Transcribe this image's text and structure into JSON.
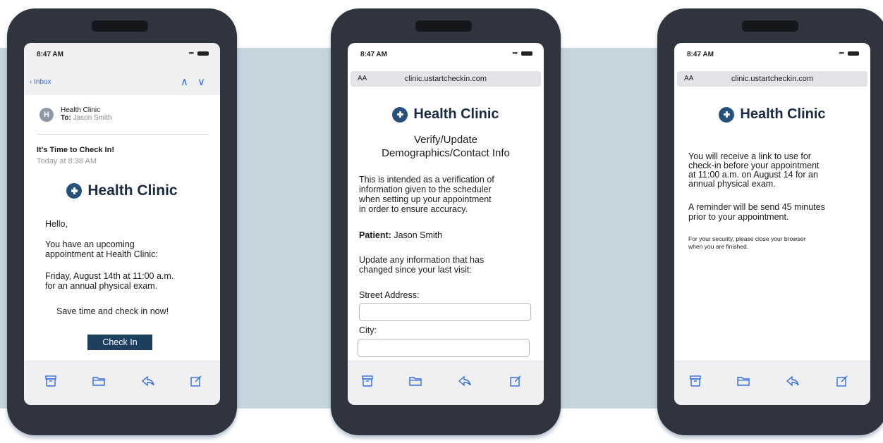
{
  "status": {
    "time": "8:47 AM",
    "signal": "•••"
  },
  "brand": {
    "name": "Health Clinic",
    "accent": "#27517d",
    "band_color": "#c5d5de"
  },
  "phone1": {
    "back_label": "Inbox",
    "nav_up": "∧",
    "nav_down": "∨",
    "avatar_letter": "H",
    "sender": "Health Clinic",
    "to_label": "To:",
    "to_name": "Jason Smith",
    "subject": "It's Time to Check In!",
    "date": "Today at 8:38 AM",
    "greeting": "Hello,",
    "body1_line1": "You have an upcoming",
    "body1_line2": "appointment at Health Clinic:",
    "body2_line1": "Friday, August 14th at 11:00 a.m.",
    "body2_line2": "for an annual physical exam.",
    "cta_text": "Save time and check in now!",
    "button": "Check In"
  },
  "phone2": {
    "aa": "AA",
    "url": "clinic.ustartcheckin.com",
    "heading_line1": "Verify/Update",
    "heading_line2": "Demographics/Contact Info",
    "intro_line1": "This is intended as a verification of",
    "intro_line2": "information given to the scheduler",
    "intro_line3": "when setting up your appointment",
    "intro_line4": "in order to ensure accuracy.",
    "patient_label": "Patient:",
    "patient_name": "Jason Smith",
    "update_line1": "Update any information that has",
    "update_line2": "changed since your last visit:",
    "street_label": "Street Address:",
    "street_value": "",
    "city_label": "City:",
    "city_value": ""
  },
  "phone3": {
    "aa": "AA",
    "url": "clinic.ustartcheckin.com",
    "msg1_line1": "You will receive a link to use for",
    "msg1_line2": "check-in before your appointment",
    "msg1_line3": "at 11:00 a.m. on August 14 for an",
    "msg1_line4": "annual physical exam.",
    "msg2_line1": "A reminder will be send 45 minutes",
    "msg2_line2": "prior to your appointment.",
    "security_line1": "For your security, please close your browser",
    "security_line2": "when you are finished."
  },
  "toolbar_icons": [
    "archive-icon",
    "folder-icon",
    "reply-icon",
    "compose-icon"
  ]
}
